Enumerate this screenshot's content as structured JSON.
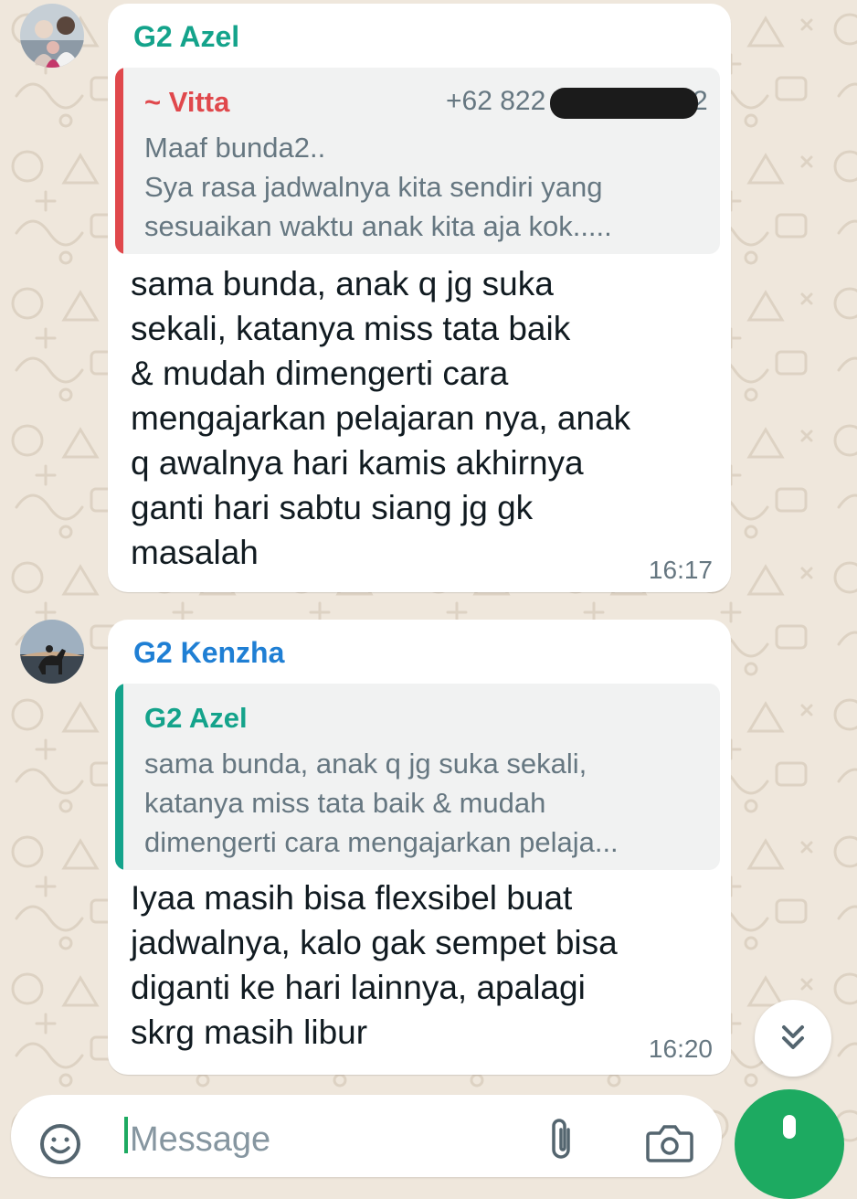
{
  "colors": {
    "wallpaper": "#efe7dc",
    "bubble": "#ffffff",
    "quote_bg": "#f1f2f2",
    "sender_azel": "#14a38b",
    "sender_kenzha": "#1f7fd4",
    "quote_vitta": "#e0484c",
    "meta_text": "#667781",
    "accent_green": "#1daa61"
  },
  "messages": [
    {
      "sender": "G2 Azel",
      "avatar": "family-photo-avatar",
      "quoted": {
        "name": "~ Vitta",
        "phone": "+62 822",
        "phone_tail": "2",
        "lines": [
          "Maaf bunda2..",
          "Sya rasa jadwalnya kita sendiri yang",
          "sesuaikan waktu anak kita aja kok....."
        ]
      },
      "lines": [
        "sama bunda, anak q jg suka",
        "sekali, katanya miss tata baik",
        "& mudah dimengerti cara",
        "mengajarkan pelajaran nya, anak",
        "q awalnya hari kamis akhirnya",
        "ganti hari sabtu siang jg gk",
        "masalah"
      ],
      "time": "16:17"
    },
    {
      "sender": "G2 Kenzha",
      "avatar": "horse-photo-avatar",
      "quoted": {
        "name": "G2 Azel",
        "lines": [
          "sama bunda, anak q jg suka sekali,",
          "katanya miss tata baik & mudah",
          "dimengerti cara mengajarkan pelaja..."
        ]
      },
      "lines": [
        "Iyaa masih bisa flexsibel buat",
        "jadwalnya, kalo gak sempet bisa",
        "diganti ke hari lainnya, apalagi",
        "skrg masih libur"
      ],
      "time": "16:20"
    }
  ],
  "composer": {
    "placeholder": "Message",
    "emoji_icon": "emoji-icon",
    "attach_icon": "paperclip-icon",
    "camera_icon": "camera-icon",
    "send_icon": "mic-icon"
  },
  "scroll_button": {
    "icon": "double-chevron-down-icon"
  }
}
